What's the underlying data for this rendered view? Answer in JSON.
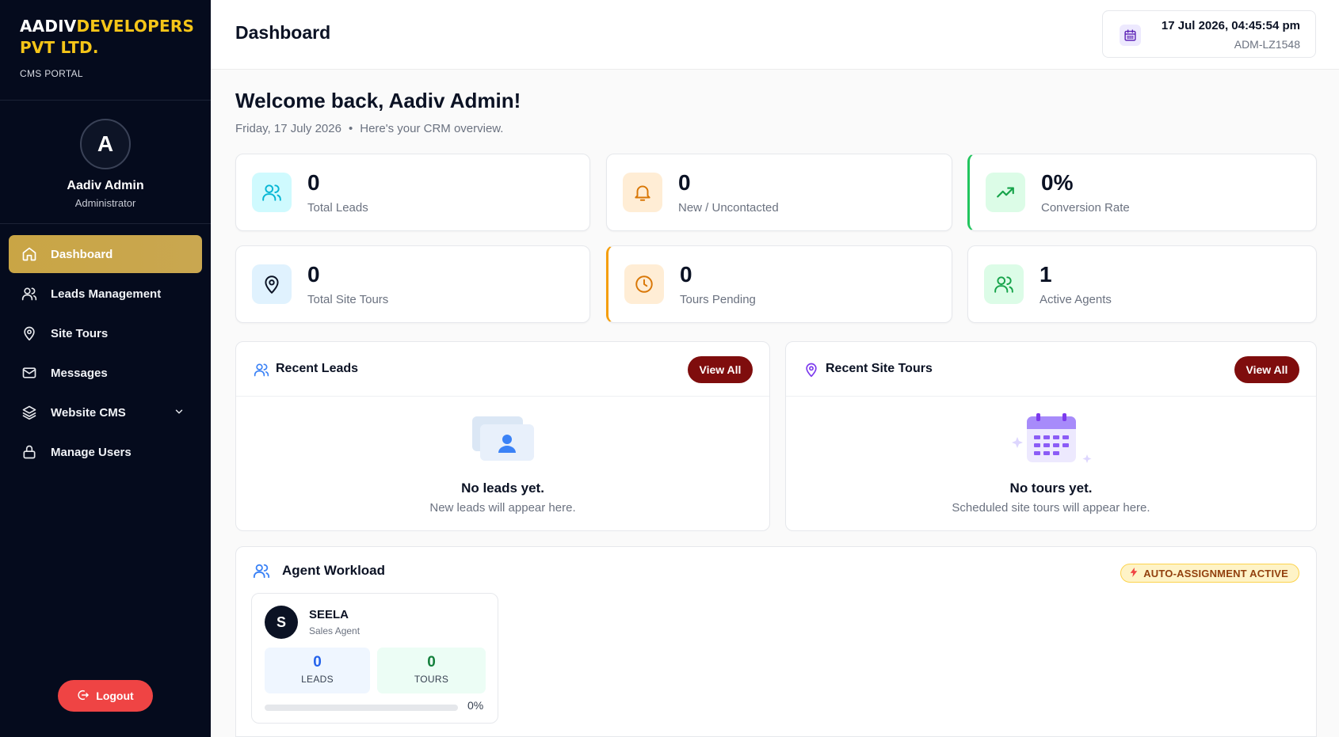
{
  "sidebar": {
    "brand_white": "AADIV",
    "brand_yellow": "DEVELOPERS",
    "brand_line2": "PVT LTD.",
    "brand_sub": "CMS PORTAL",
    "avatar_letter": "A",
    "user_name": "Aadiv Admin",
    "user_role": "Administrator",
    "nav": [
      {
        "label": "Dashboard",
        "icon": "home-icon",
        "active": true
      },
      {
        "label": "Leads Management",
        "icon": "users-icon"
      },
      {
        "label": "Site Tours",
        "icon": "map-pin-icon"
      },
      {
        "label": "Messages",
        "icon": "mail-icon"
      },
      {
        "label": "Website CMS",
        "icon": "layers-icon",
        "has_dropdown": true
      },
      {
        "label": "Manage Users",
        "icon": "lock-icon"
      }
    ],
    "logout_label": "Logout"
  },
  "header": {
    "title": "Dashboard",
    "datetime": "17 Jul 2026, 04:45:54 pm",
    "user_id": "ADM-LZ1548"
  },
  "welcome": {
    "title": "Welcome back, Aadiv Admin!",
    "date": "Friday, 17 July 2026",
    "separator": "•",
    "subtitle": "Here's your CRM overview."
  },
  "stats": [
    {
      "value": "0",
      "label": "Total Leads",
      "icon": "users-icon"
    },
    {
      "value": "0",
      "label": "New / Uncontacted",
      "icon": "bell-icon"
    },
    {
      "value": "0%",
      "label": "Conversion Rate",
      "icon": "trending-up-icon"
    },
    {
      "value": "0",
      "label": "Total Site Tours",
      "icon": "map-pin-icon"
    },
    {
      "value": "0",
      "label": "Tours Pending",
      "icon": "clock-icon"
    },
    {
      "value": "1",
      "label": "Active Agents",
      "icon": "users-icon"
    }
  ],
  "recent_leads": {
    "title": "Recent Leads",
    "view_all": "View All",
    "empty_title": "No leads yet.",
    "empty_sub": "New leads will appear here."
  },
  "recent_tours": {
    "title": "Recent Site Tours",
    "view_all": "View All",
    "empty_title": "No tours yet.",
    "empty_sub": "Scheduled site tours will appear here."
  },
  "workload": {
    "title": "Agent Workload",
    "badge": "AUTO-ASSIGNMENT ACTIVE",
    "agent": {
      "initial": "S",
      "name": "SEELA",
      "role": "Sales Agent",
      "leads_value": "0",
      "leads_label": "LEADS",
      "tours_value": "0",
      "tours_label": "TOURS",
      "progress_fraction": 0,
      "progress_text": "0%"
    }
  },
  "colors": {
    "sidebar_bg": "#050b1d",
    "brand_yellow": "#f5c518",
    "active_gold": "#c9a545",
    "view_all": "#7f0d0d",
    "logout": "#ef4444"
  }
}
